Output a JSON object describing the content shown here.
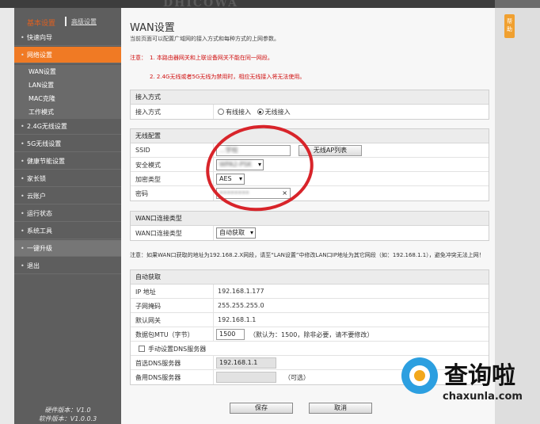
{
  "app": {
    "logo": "DHICOWA"
  },
  "help_tab": "帮助",
  "sidebar": {
    "header_primary": "基本设置",
    "header_secondary": "高级设置",
    "menu": [
      {
        "label": "快速向导"
      },
      {
        "label": "网络设置"
      },
      {
        "label": "2.4G无线设置"
      },
      {
        "label": "5G无线设置"
      },
      {
        "label": "健康节能设置"
      },
      {
        "label": "家长锁"
      },
      {
        "label": "云账户"
      },
      {
        "label": "运行状态"
      },
      {
        "label": "系统工具"
      },
      {
        "label": "一键升级"
      },
      {
        "label": "退出"
      }
    ],
    "submenu": [
      "WAN设置",
      "LAN设置",
      "MAC克隆",
      "工作模式"
    ],
    "hardware_version": "硬件版本：V1.0",
    "software_version": "软件版本：V1.0.0.3"
  },
  "page": {
    "title": "WAN设置",
    "description": "当前页面可以配置广域网的接入方式和每种方式的上网参数。",
    "note_label": "注意：",
    "note_line1": "1. 本路由器网关和上联设备网关不能在同一网段。",
    "note_line2": "2. 2.4G无线或者5G无线为禁用时，相应无线接入将无法使用。"
  },
  "access": {
    "header": "接入方式",
    "label": "接入方式",
    "options": [
      {
        "label": "有线接入",
        "selected": false
      },
      {
        "label": "无线接入",
        "selected": true
      }
    ]
  },
  "wireless": {
    "header": "无线配置",
    "ssid_label": "SSID",
    "ssid_value": "...学校",
    "ap_list_button": "无线AP列表",
    "security_label": "安全模式",
    "security_value": "WPA2-PSK",
    "encrypt_label": "加密类型",
    "encrypt_value": "AES",
    "password_label": "密码",
    "password_value": "••••••••",
    "clear_icon": "×"
  },
  "wan_type": {
    "header": "WAN口连接类型",
    "label": "WAN口连接类型",
    "value": "自动获取",
    "note": "注意：如果WAN口获取的地址为192.168.2.X网段，请至“LAN设置”中修改LAN口IP地址为其它网段（如：192.168.1.1），避免冲突无法上网！"
  },
  "auto": {
    "header": "自动获取",
    "ip_label": "IP 地址",
    "ip_value": "192.168.1.177",
    "mask_label": "子网掩码",
    "mask_value": "255.255.255.0",
    "gateway_label": "默认网关",
    "gateway_value": "192.168.1.1",
    "mtu_label": "数据包MTU（字节）",
    "mtu_value": "1500",
    "mtu_hint": "（默认为：1500，除非必要，请不要修改）",
    "manual_dns_label": "手动设置DNS服务器",
    "dns1_label": "首选DNS服务器",
    "dns1_value": "192.168.1.1",
    "dns2_label": "备用DNS服务器",
    "dns2_value": "",
    "dns2_hint": "（可选）"
  },
  "actions": {
    "save": "保存",
    "cancel": "取消"
  },
  "watermark": {
    "text": "查询啦",
    "url": "chaxunla.com"
  },
  "colors": {
    "accent": "#f07a24",
    "annotation_circle": "#d8242a",
    "note_red": "#d01010"
  }
}
